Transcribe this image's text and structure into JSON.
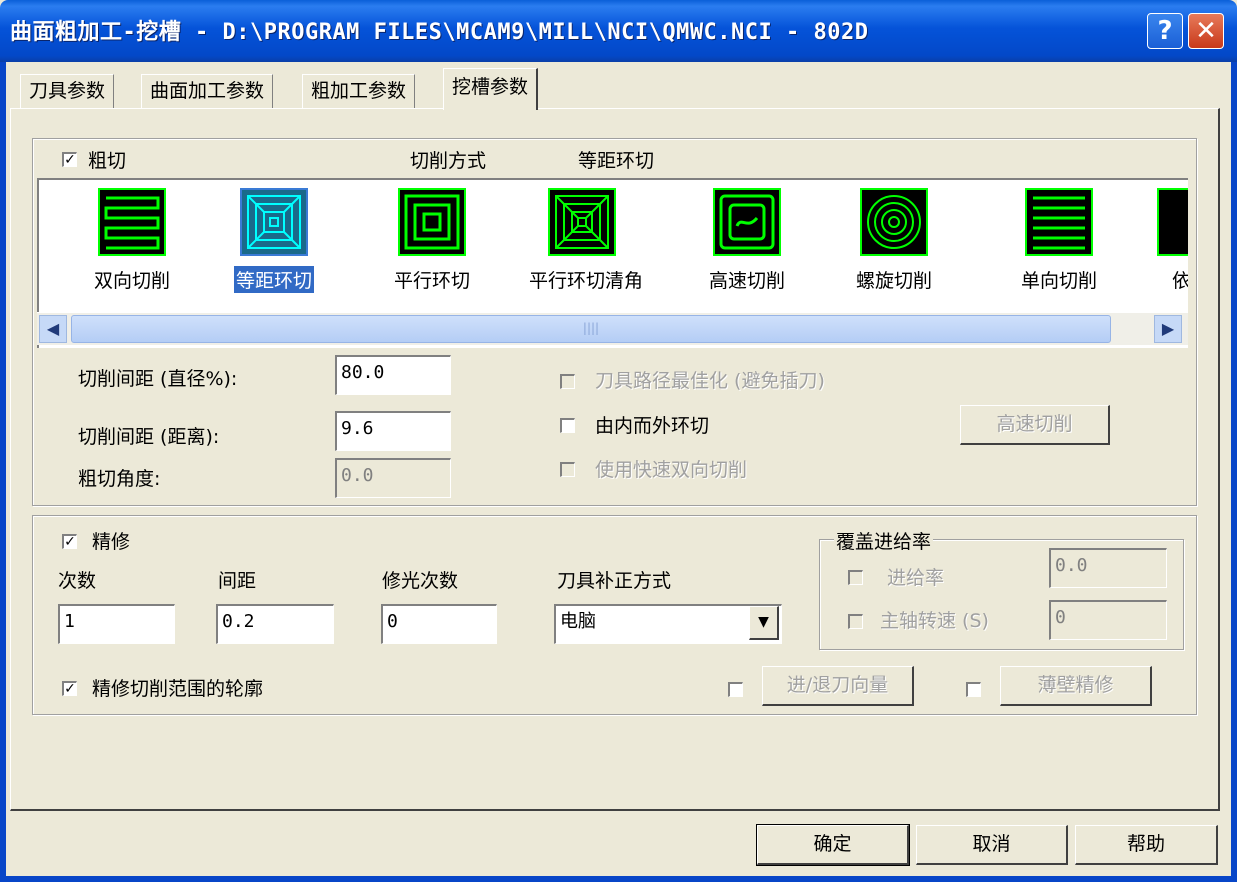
{
  "window": {
    "title": "曲面粗加工-挖槽 - D:\\PROGRAM FILES\\MCAM9\\MILL\\NCI\\QMWC.NCI - 802D",
    "help_glyph": "?",
    "close_glyph": "✕"
  },
  "tabs": [
    {
      "label": "刀具参数"
    },
    {
      "label": "曲面加工参数"
    },
    {
      "label": "粗加工参数"
    },
    {
      "label": "挖槽参数"
    }
  ],
  "rough": {
    "checkbox_label": "粗切",
    "checked": true,
    "cut_method_label": "切削方式",
    "cut_method_value": "等距环切",
    "patterns": [
      {
        "label": "双向切削",
        "icon": "zigzag-pattern-icon"
      },
      {
        "label": "等距环切",
        "icon": "constant-overlap-spiral-icon",
        "selected": true
      },
      {
        "label": "平行环切",
        "icon": "parallel-spiral-icon"
      },
      {
        "label": "平行环切清角",
        "icon": "parallel-spiral-clean-corners-icon"
      },
      {
        "label": "高速切削",
        "icon": "high-speed-pattern-icon"
      },
      {
        "label": "螺旋切削",
        "icon": "true-spiral-icon"
      },
      {
        "label": "单向切削",
        "icon": "one-way-pattern-icon"
      },
      {
        "label": "依夕",
        "icon": "morph-spiral-icon"
      }
    ],
    "stepover_pct_label": "切削间距 (直径%):",
    "stepover_pct_value": "80.0",
    "stepover_dist_label": "切削间距 (距离):",
    "stepover_dist_value": "9.6",
    "angle_label": "粗切角度:",
    "angle_value": "0.0",
    "opt_tool_path_label": "刀具路径最佳化 (避免插刀)",
    "inside_out_label": "由内而外环切",
    "fast_zigzag_label": "使用快速双向切削",
    "high_speed_btn": "高速切削"
  },
  "finish": {
    "checkbox_label": "精修",
    "checked": true,
    "count_label": "次数",
    "count_value": "1",
    "spacing_label": "间距",
    "spacing_value": "0.2",
    "spring_label": "修光次数",
    "spring_value": "0",
    "comp_label": "刀具补正方式",
    "comp_value": "电脑",
    "override_title": "覆盖进给率",
    "feed_label": "进给率",
    "feed_value": "0.0",
    "spindle_label": "主轴转速 (S)",
    "spindle_value": "0",
    "contour_label": "精修切削范围的轮廓",
    "contour_checked": true,
    "lead_btn": "进/退刀向量",
    "thin_wall_btn": "薄壁精修"
  },
  "footer": {
    "ok": "确定",
    "cancel": "取消",
    "help": "帮助"
  }
}
